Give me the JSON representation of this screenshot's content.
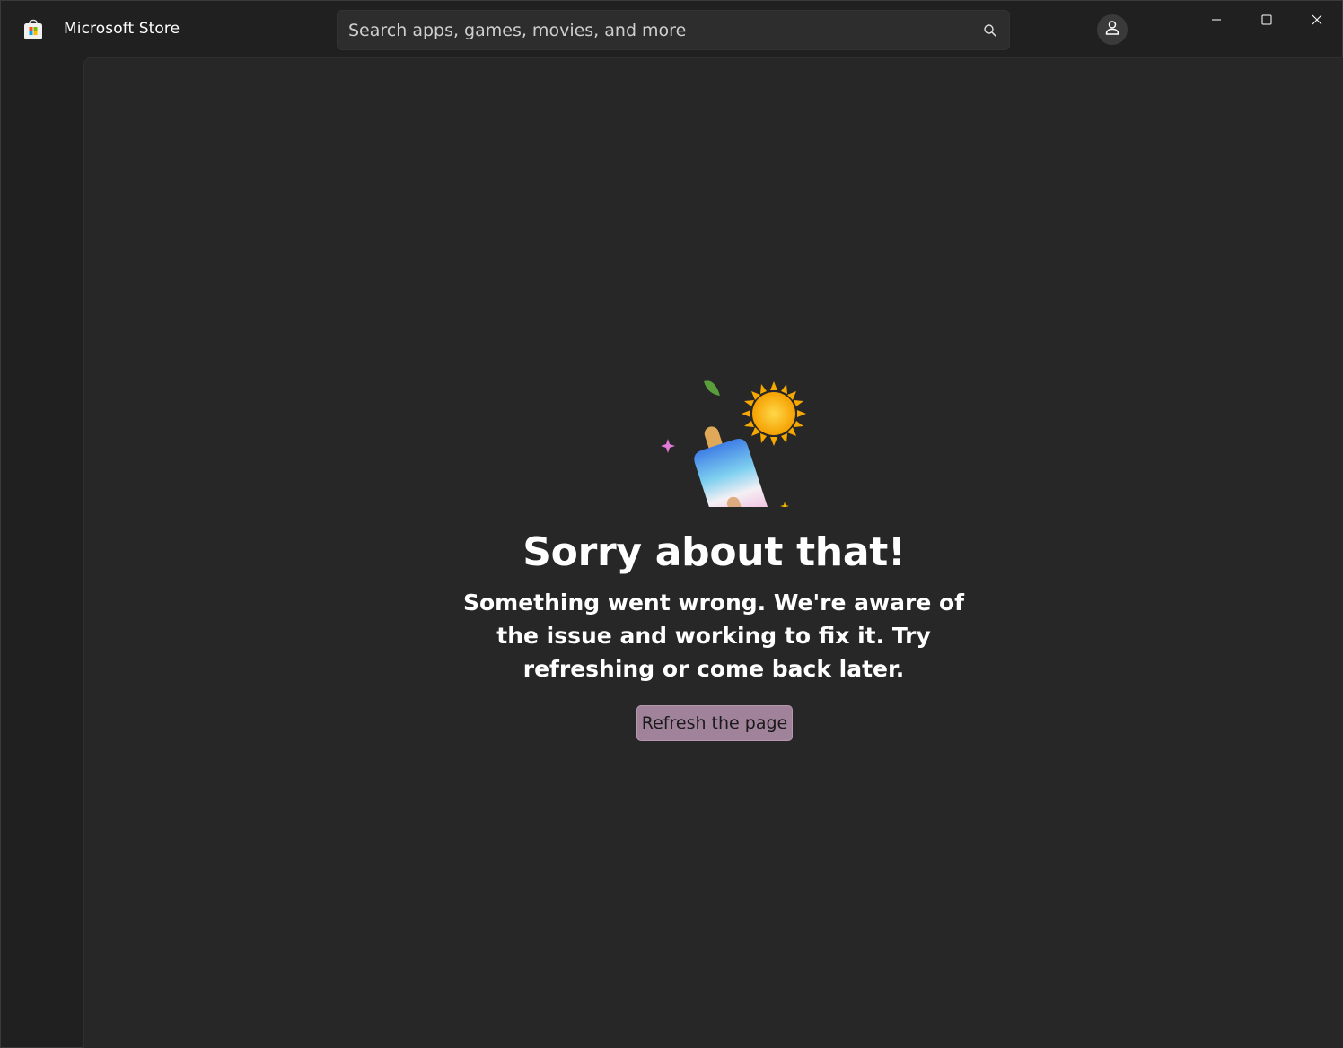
{
  "app": {
    "title": "Microsoft Store",
    "logo_icon": "microsoft-store-icon"
  },
  "search": {
    "placeholder": "Search apps, games, movies, and more",
    "icon": "search-icon"
  },
  "account": {
    "icon": "person-icon"
  },
  "window_controls": {
    "minimize_icon": "minimize-icon",
    "maximize_icon": "maximize-icon",
    "close_icon": "close-icon"
  },
  "error": {
    "illustration": "melting-popsicle-illustration",
    "title": "Sorry about that!",
    "message": "Something went wrong. We're aware of the issue and working to fix it. Try refreshing or come back later.",
    "refresh_label": "Refresh the page"
  },
  "colors": {
    "background": "#202020",
    "content_background": "#272727",
    "accent": "#a0829a"
  }
}
